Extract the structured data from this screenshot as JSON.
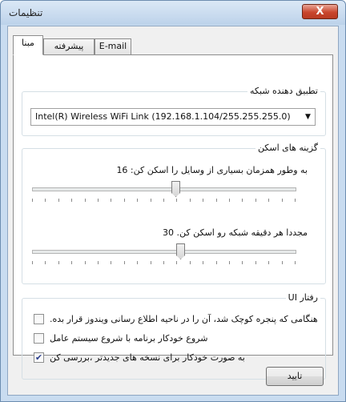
{
  "window": {
    "title": "تنظیمات",
    "close_glyph": "X"
  },
  "tabs": [
    {
      "label": "مبنا",
      "active": true
    },
    {
      "label": "پیشرفته",
      "active": false
    },
    {
      "label": "E-mail",
      "active": false
    }
  ],
  "adapter_group": {
    "legend": "تطبیق دهنده شبکه",
    "selected": "Intel(R) Wireless WiFi Link (192.168.1.104/255.255.255.0)",
    "arrow_icon": "chevron-down-icon"
  },
  "scan_group": {
    "legend": "گزینه های اسکن",
    "simultaneous_label": "به وطور همزمان بسیاری از وسایل را اسکن کن: 16",
    "simultaneous_value": 16,
    "rescan_label": "مجددا هر دقیقه شبکه رو اسکن کن. 30",
    "rescan_value": 30
  },
  "ui_group": {
    "legend": "UI رفتار",
    "options": [
      {
        "label": ".هنگامی که پنجره کوچک شد، آن را در ناحیه اطلاع رسانی ویندوز قرار بده",
        "checked": false
      },
      {
        "label": "شروع خودکار برنامه با شروع سیستم عامل",
        "checked": false
      },
      {
        "label": "به صورت خودکار برای نسخه های جدیدتر ،بررسی کن",
        "checked": true
      }
    ]
  },
  "ok_button": "تایید"
}
